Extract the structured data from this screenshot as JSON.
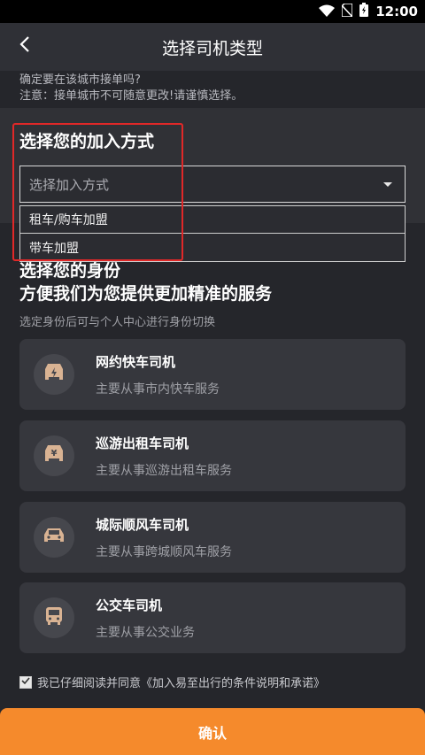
{
  "status_bar": {
    "time": "12:00"
  },
  "app_bar": {
    "title": "选择司机类型"
  },
  "notice": {
    "line1": "确定要在该城市接单吗?",
    "line2": "注意：接单城市不可随意更改!请谨慎选择。"
  },
  "join": {
    "title": "选择您的加入方式",
    "placeholder": "选择加入方式",
    "options": [
      "租车/购车加盟",
      "带车加盟"
    ]
  },
  "identity": {
    "title_line1": "选择您的身份",
    "title_line2": "方便我们为您提供更加精准的服务",
    "subtitle": "选定身份后可与个人中心进行身份切换",
    "cards": [
      {
        "title": "网约快车司机",
        "desc": "主要从事市内快车服务",
        "icon": "lightning-car-icon"
      },
      {
        "title": "巡游出租车司机",
        "desc": "主要从事巡游出租车服务",
        "icon": "yen-car-icon"
      },
      {
        "title": "城际顺风车司机",
        "desc": "主要从事跨城顺风车服务",
        "icon": "car-icon"
      },
      {
        "title": "公交车司机",
        "desc": "主要从事公交业务",
        "icon": "bus-icon"
      }
    ]
  },
  "agreement": {
    "text": "我已仔细阅读并同意《加入易至出行的条件说明和承诺》",
    "checked": true
  },
  "confirm": {
    "label": "确认"
  },
  "colors": {
    "accent": "#f58a2c",
    "highlight_frame": "#e02828",
    "icon_tint": "#d9b393"
  }
}
